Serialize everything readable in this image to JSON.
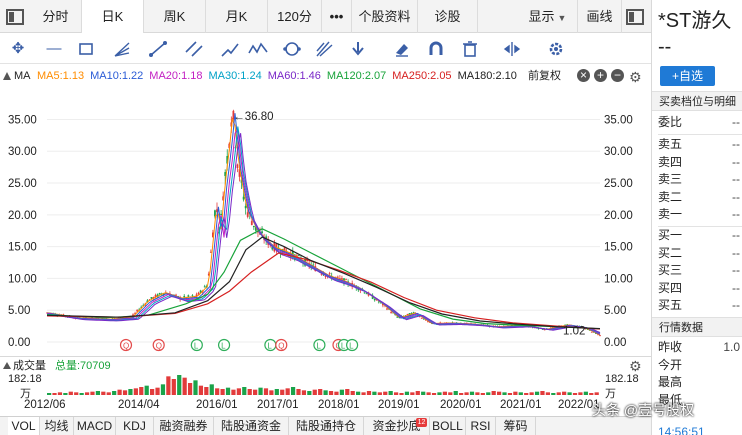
{
  "tabs": [
    {
      "label": "分时"
    },
    {
      "label": "日K"
    },
    {
      "label": "周K"
    },
    {
      "label": "月K"
    },
    {
      "label": "120分"
    },
    {
      "label": "•••"
    },
    {
      "label": "个股资料"
    },
    {
      "label": "诊股"
    },
    {
      "label": "显示"
    },
    {
      "label": "画线"
    }
  ],
  "indicator_row": {
    "name": "MA",
    "mas": [
      {
        "label": "MA5:1.13",
        "color": "#ff8c00"
      },
      {
        "label": "MA10:1.22",
        "color": "#2a5bd6"
      },
      {
        "label": "MA20:1.18",
        "color": "#c21fc2"
      },
      {
        "label": "MA30:1.24",
        "color": "#00a2c7"
      },
      {
        "label": "MA60:1.46",
        "color": "#7a28c8"
      },
      {
        "label": "MA120:2.07",
        "color": "#18a33a"
      },
      {
        "label": "MA250:2.05",
        "color": "#d62020"
      },
      {
        "label": "MA180:2.10",
        "color": "#222222"
      }
    ],
    "adjust": "前复权"
  },
  "chart_data": {
    "type": "line",
    "title": "",
    "x_tick_labels": [
      "2012/06",
      "2014/04",
      "2016/01",
      "2017/01",
      "2018/01",
      "2019/01",
      "2020/01",
      "2021/01",
      "2022/01"
    ],
    "y_tick_labels": [
      "35.00",
      "30.00",
      "25.00",
      "20.00",
      "15.00",
      "10.00",
      "5.00",
      "0.00"
    ],
    "ylim": [
      0,
      36.8
    ],
    "annotations": {
      "high": "←36.80",
      "last": "1.02"
    },
    "event_markers": [
      "Q",
      "Q",
      "L",
      "L",
      "L",
      "Q",
      "L",
      "Q",
      "L",
      "L"
    ],
    "price": {
      "x": [
        2012.45,
        2013.0,
        2013.6,
        2014.0,
        2014.3,
        2014.6,
        2014.9,
        2015.2,
        2015.4,
        2015.55,
        2015.62,
        2015.7,
        2015.78,
        2015.85,
        2015.95,
        2016.1,
        2016.3,
        2016.6,
        2016.9,
        2017.2,
        2017.6,
        2017.9,
        2018.2,
        2018.6,
        2018.9,
        2019.2,
        2019.5,
        2019.9,
        2020.3,
        2020.7,
        2021.2,
        2021.6,
        2022.0,
        2022.3,
        2022.6
      ],
      "values": [
        4.6,
        3.8,
        3.6,
        3.9,
        6.5,
        7.8,
        6.9,
        7.2,
        9.0,
        22.0,
        17.0,
        25.0,
        30.5,
        36.8,
        28.0,
        21.0,
        17.5,
        15.0,
        14.0,
        12.5,
        10.5,
        9.6,
        8.4,
        6.0,
        3.8,
        4.6,
        2.9,
        3.0,
        2.8,
        2.4,
        2.6,
        2.0,
        2.7,
        2.3,
        1.02
      ]
    },
    "series": [
      {
        "name": "MA120",
        "color": "#18a33a",
        "x": [
          2012.45,
          2013.5,
          2014.3,
          2015.0,
          2015.4,
          2015.7,
          2016.0,
          2016.4,
          2016.8,
          2017.3,
          2017.8,
          2018.3,
          2018.8,
          2019.3,
          2019.9,
          2020.5,
          2021.2,
          2021.8,
          2022.3,
          2022.6
        ],
        "values": [
          4.3,
          3.8,
          4.2,
          6.0,
          7.5,
          11.0,
          16.0,
          17.8,
          16.2,
          14.0,
          11.8,
          9.6,
          7.4,
          5.2,
          3.6,
          2.9,
          2.6,
          2.4,
          2.2,
          2.07
        ]
      },
      {
        "name": "MA250",
        "color": "#d62020",
        "x": [
          2012.45,
          2013.8,
          2014.8,
          2015.4,
          2015.8,
          2016.2,
          2016.7,
          2017.2,
          2017.8,
          2018.4,
          2019.0,
          2019.6,
          2020.3,
          2021.0,
          2021.8,
          2022.6
        ],
        "values": [
          4.1,
          3.9,
          4.5,
          6.0,
          8.0,
          11.0,
          14.0,
          13.0,
          11.3,
          9.4,
          7.0,
          5.0,
          3.8,
          3.0,
          2.5,
          2.05
        ]
      },
      {
        "name": "MA180",
        "color": "#222222",
        "x": [
          2012.45,
          2013.8,
          2014.8,
          2015.4,
          2015.8,
          2016.1,
          2016.4,
          2016.8,
          2017.3,
          2017.9,
          2018.5,
          2019.1,
          2019.7,
          2020.4,
          2021.1,
          2021.8,
          2022.6
        ],
        "values": [
          4.2,
          3.9,
          4.6,
          6.5,
          9.5,
          14.5,
          16.5,
          15.0,
          12.8,
          10.8,
          8.6,
          6.2,
          4.4,
          3.3,
          2.8,
          2.4,
          2.1
        ]
      }
    ]
  },
  "volume": {
    "label": "成交量",
    "total": "总量:70709",
    "top_left": "182.18",
    "top_right": "182.18",
    "unit": "万",
    "bars": [
      3,
      3,
      4,
      3,
      5,
      4,
      3,
      4,
      5,
      6,
      5,
      4,
      6,
      8,
      7,
      9,
      10,
      12,
      14,
      9,
      11,
      16,
      28,
      24,
      30,
      26,
      18,
      22,
      14,
      12,
      16,
      10,
      9,
      11,
      8,
      10,
      12,
      9,
      8,
      11,
      10,
      7,
      9,
      8,
      10,
      12,
      9,
      7,
      6,
      8,
      9,
      7,
      6,
      5,
      8,
      9,
      6,
      5,
      4,
      6,
      5,
      4,
      5,
      6,
      4,
      3,
      5,
      4,
      6,
      5,
      4,
      3,
      4,
      5,
      4,
      6,
      3,
      4,
      5,
      4,
      3,
      4,
      6,
      5,
      4,
      3,
      5,
      4,
      3,
      4,
      5,
      6,
      4,
      3,
      4,
      5,
      4,
      3,
      4,
      5,
      3,
      4
    ]
  },
  "bottom_tabs": [
    {
      "label": "VOL"
    },
    {
      "label": "均线"
    },
    {
      "label": "MACD"
    },
    {
      "label": "KDJ"
    },
    {
      "label": "融资融券"
    },
    {
      "label": "陆股通资金"
    },
    {
      "label": "陆股通持仓"
    },
    {
      "label": "资金抄底",
      "badge": "12"
    },
    {
      "label": "BOLL"
    },
    {
      "label": "RSI"
    },
    {
      "label": "筹码"
    }
  ],
  "right_panel": {
    "name": "*ST游久",
    "code": "--",
    "add_button": "+自选",
    "orderbook_title": "买卖档位与明细",
    "weibi_label": "委比",
    "weibi_value": "--",
    "asks": [
      {
        "label": "卖五",
        "value": "--"
      },
      {
        "label": "卖四",
        "value": "--"
      },
      {
        "label": "卖三",
        "value": "--"
      },
      {
        "label": "卖二",
        "value": "--"
      },
      {
        "label": "卖一",
        "value": "--"
      }
    ],
    "bids": [
      {
        "label": "买一",
        "value": "--"
      },
      {
        "label": "买二",
        "value": "--"
      },
      {
        "label": "买三",
        "value": "--"
      },
      {
        "label": "买四",
        "value": "--"
      },
      {
        "label": "买五",
        "value": "--"
      }
    ],
    "market_title": "行情数据",
    "market": [
      {
        "label": "昨收",
        "value": "1.0"
      },
      {
        "label": "今开",
        "value": ""
      },
      {
        "label": "最高",
        "value": ""
      },
      {
        "label": "最低",
        "value": ""
      }
    ],
    "clock": "14:56:51"
  },
  "watermark": "头条 @壹号股权"
}
